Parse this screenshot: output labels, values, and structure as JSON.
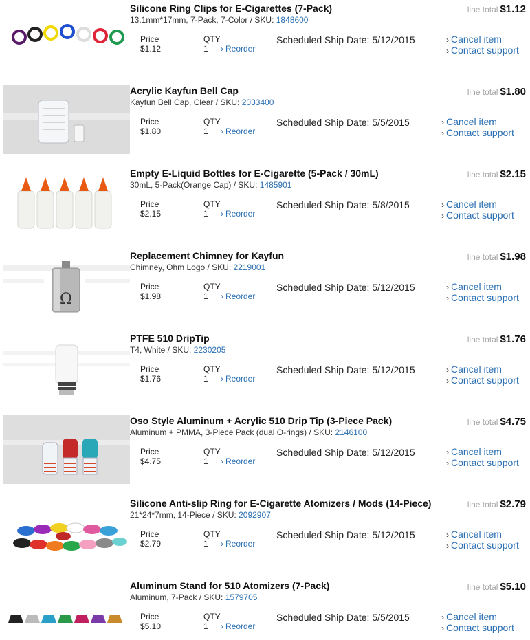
{
  "labels": {
    "line_total": "line total",
    "price": "Price",
    "qty": "QTY",
    "reorder": "Reorder",
    "ship_prefix": "Scheduled Ship Date:",
    "cancel": "Cancel item",
    "contact": "Contact support",
    "chevron": "›"
  },
  "items": [
    {
      "title": "Silicone Ring Clips for E-Cigarettes (7-Pack)",
      "desc": "13.1mm*17mm, 7-Pack, 7-Color / SKU:",
      "sku": "1848600",
      "line_total": "$1.12",
      "price": "$1.12",
      "qty": "1",
      "ship_date": "5/12/2015",
      "image_icon": "ring-clips-product-image"
    },
    {
      "title": "Acrylic Kayfun Bell Cap",
      "desc": "Kayfun Bell Cap, Clear / SKU:",
      "sku": "2033400",
      "line_total": "$1.80",
      "price": "$1.80",
      "qty": "1",
      "ship_date": "5/5/2015",
      "image_icon": "bell-cap-product-image"
    },
    {
      "title": "Empty E-Liquid Bottles for E-Cigarette (5-Pack / 30mL)",
      "desc": "30mL, 5-Pack(Orange Cap) / SKU:",
      "sku": "1485901",
      "line_total": "$2.15",
      "price": "$2.15",
      "qty": "1",
      "ship_date": "5/8/2015",
      "image_icon": "bottles-product-image"
    },
    {
      "title": "Replacement Chimney for Kayfun",
      "desc": "Chimney, Ohm Logo / SKU:",
      "sku": "2219001",
      "line_total": "$1.98",
      "price": "$1.98",
      "qty": "1",
      "ship_date": "5/12/2015",
      "image_icon": "chimney-product-image"
    },
    {
      "title": "PTFE 510 DripTip",
      "desc": "T4, White / SKU:",
      "sku": "2230205",
      "line_total": "$1.76",
      "price": "$1.76",
      "qty": "1",
      "ship_date": "5/12/2015",
      "image_icon": "drip-tip-product-image"
    },
    {
      "title": "Oso Style Aluminum + Acrylic 510 Drip Tip (3-Piece Pack)",
      "desc": "Aluminum + PMMA, 3-Piece Pack (dual O-rings) / SKU:",
      "sku": "2146100",
      "line_total": "$4.75",
      "price": "$4.75",
      "qty": "1",
      "ship_date": "5/12/2015",
      "image_icon": "oso-drip-tips-product-image"
    },
    {
      "title": "Silicone Anti-slip Ring for E-Cigarette Atomizers / Mods (14-Piece)",
      "desc": "21*24*7mm, 14-Piece / SKU:",
      "sku": "2092907",
      "line_total": "$2.79",
      "price": "$2.79",
      "qty": "1",
      "ship_date": "5/12/2015",
      "image_icon": "anti-slip-rings-product-image"
    },
    {
      "title": "Aluminum Stand for 510 Atomizers (7-Pack)",
      "desc": "Aluminum, 7-Pack / SKU:",
      "sku": "1579705",
      "line_total": "$5.10",
      "price": "$5.10",
      "qty": "1",
      "ship_date": "5/5/2015",
      "image_icon": "atomizer-stands-product-image"
    }
  ],
  "colors": {
    "link": "#2a6fb3",
    "muted": "#a5a5a5",
    "text": "#222222"
  }
}
